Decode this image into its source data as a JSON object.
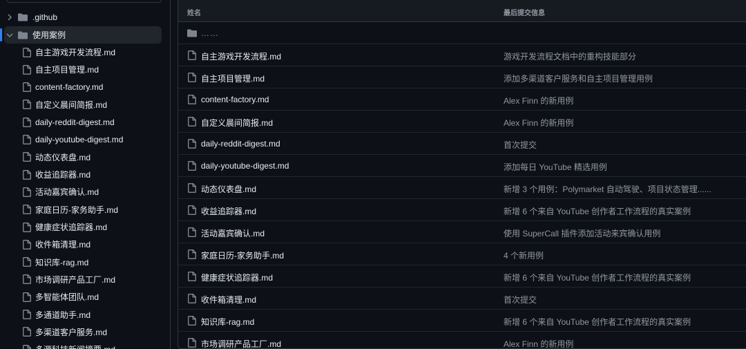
{
  "sidebar": {
    "folders": [
      {
        "label": ".github",
        "expanded": false
      },
      {
        "label": "使用案例",
        "expanded": true
      }
    ],
    "files": [
      "自主游戏开发流程.md",
      "自主项目管理.md",
      "content-factory.md",
      "自定义晨间简报.md",
      "daily-reddit-digest.md",
      "daily-youtube-digest.md",
      "动态仪表盘.md",
      "收益追踪器.md",
      "活动嘉宾确认.md",
      "家庭日历-家务助手.md",
      "健康症状追踪器.md",
      "收件箱清理.md",
      "知识库-rag.md",
      "市场调研产品工厂.md",
      "多智能体团队.md",
      "多通道助手.md",
      "多渠道客户服务.md",
      "多源科技新闻摘要.md"
    ]
  },
  "table": {
    "header": {
      "name": "姓名",
      "commit": "最后提交信息"
    },
    "parent_label": "……",
    "rows": [
      {
        "name": "自主游戏开发流程.md",
        "message": "游戏开发流程文档中的重构技能部分"
      },
      {
        "name": "自主项目管理.md",
        "message": "添加多渠道客户服务和自主项目管理用例"
      },
      {
        "name": "content-factory.md",
        "message": "Alex Finn 的新用例"
      },
      {
        "name": "自定义晨间简报.md",
        "message": "Alex Finn 的新用例"
      },
      {
        "name": "daily-reddit-digest.md",
        "message": "首次提交"
      },
      {
        "name": "daily-youtube-digest.md",
        "message": "添加每日 YouTube 精选用例"
      },
      {
        "name": "动态仪表盘.md",
        "message": "新增 3 个用例：Polymarket 自动驾驶、项目状态管理......"
      },
      {
        "name": "收益追踪器.md",
        "message": "新增 6 个来自 YouTube 创作者工作流程的真实案例"
      },
      {
        "name": "活动嘉宾确认.md",
        "message": "使用 SuperCall 插件添加活动来宾确认用例"
      },
      {
        "name": "家庭日历-家务助手.md",
        "message": "4 个新用例"
      },
      {
        "name": "健康症状追踪器.md",
        "message": "新增 6 个来自 YouTube 创作者工作流程的真实案例"
      },
      {
        "name": "收件箱清理.md",
        "message": "首次提交"
      },
      {
        "name": "知识库-rag.md",
        "message": "新增 6 个来自 YouTube 创作者工作流程的真实案例"
      },
      {
        "name": "市场调研产品工厂.md",
        "message": "Alex Finn 的新用例"
      }
    ]
  },
  "colors": {
    "background": "#0d1117",
    "header_bg": "#161b22",
    "border": "#30363d",
    "text": "#e6edf3",
    "muted": "#9198a1",
    "active_row": "#21262d",
    "accent": "#2f81f7"
  },
  "icons": {
    "folder": "folder-icon",
    "file": "file-icon",
    "chevron_right": "chevron-right-icon",
    "chevron_down": "chevron-down-icon"
  }
}
